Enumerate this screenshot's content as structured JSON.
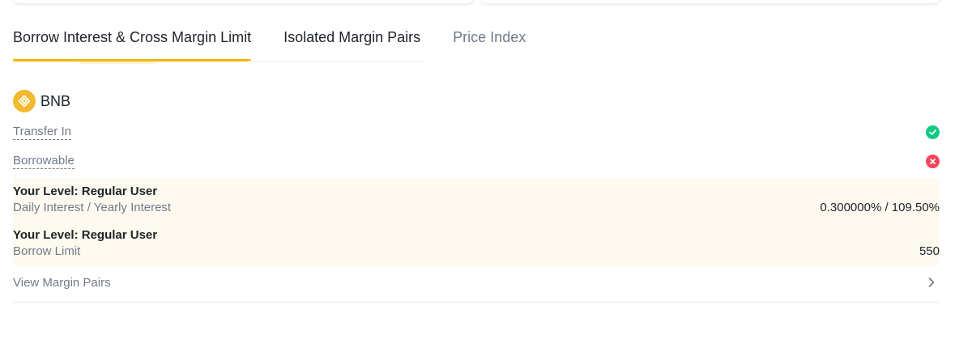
{
  "tabs": [
    {
      "label": "Borrow Interest & Cross Margin Limit",
      "active": true
    },
    {
      "label": "Isolated Margin Pairs",
      "active": false
    },
    {
      "label": "Price Index",
      "active": false
    }
  ],
  "coin": {
    "name": "BNB",
    "icon": "bnb-coin-icon"
  },
  "properties": {
    "transfer_in": {
      "label": "Transfer In",
      "status": "check-icon",
      "enabled": true
    },
    "borrowable": {
      "label": "Borrowable",
      "status": "cross-icon",
      "enabled": false
    }
  },
  "levels": [
    {
      "title": "Your Level: Regular User",
      "subtitle": "Daily Interest / Yearly Interest",
      "value": "0.300000% / 109.50%"
    },
    {
      "title": "Your Level: Regular User",
      "subtitle": "Borrow Limit",
      "value": "550"
    }
  ],
  "view_margin_pairs": {
    "label": "View Margin Pairs",
    "icon": "chevron-right-icon"
  },
  "colors": {
    "accent": "#f0b90b",
    "success": "#0ecb81",
    "danger": "#f6465d",
    "highlight_bg": "#fefaef"
  }
}
